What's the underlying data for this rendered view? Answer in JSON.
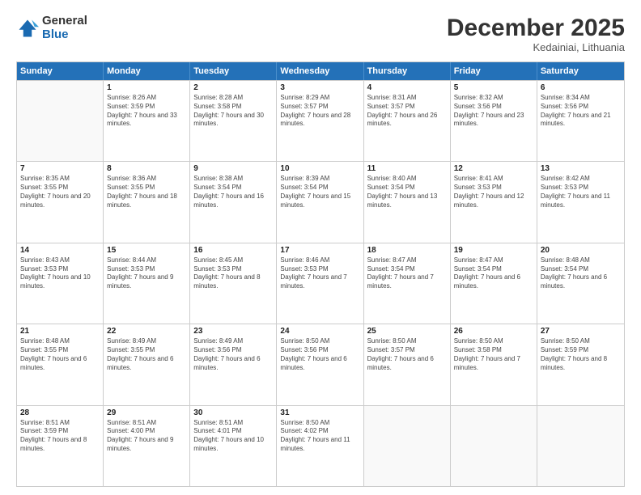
{
  "logo": {
    "general": "General",
    "blue": "Blue"
  },
  "header": {
    "month": "December 2025",
    "location": "Kedainiai, Lithuania"
  },
  "days": [
    "Sunday",
    "Monday",
    "Tuesday",
    "Wednesday",
    "Thursday",
    "Friday",
    "Saturday"
  ],
  "weeks": [
    [
      {
        "day": "",
        "empty": true
      },
      {
        "day": "1",
        "sunrise": "Sunrise: 8:26 AM",
        "sunset": "Sunset: 3:59 PM",
        "daylight": "Daylight: 7 hours and 33 minutes."
      },
      {
        "day": "2",
        "sunrise": "Sunrise: 8:28 AM",
        "sunset": "Sunset: 3:58 PM",
        "daylight": "Daylight: 7 hours and 30 minutes."
      },
      {
        "day": "3",
        "sunrise": "Sunrise: 8:29 AM",
        "sunset": "Sunset: 3:57 PM",
        "daylight": "Daylight: 7 hours and 28 minutes."
      },
      {
        "day": "4",
        "sunrise": "Sunrise: 8:31 AM",
        "sunset": "Sunset: 3:57 PM",
        "daylight": "Daylight: 7 hours and 26 minutes."
      },
      {
        "day": "5",
        "sunrise": "Sunrise: 8:32 AM",
        "sunset": "Sunset: 3:56 PM",
        "daylight": "Daylight: 7 hours and 23 minutes."
      },
      {
        "day": "6",
        "sunrise": "Sunrise: 8:34 AM",
        "sunset": "Sunset: 3:56 PM",
        "daylight": "Daylight: 7 hours and 21 minutes."
      }
    ],
    [
      {
        "day": "7",
        "sunrise": "Sunrise: 8:35 AM",
        "sunset": "Sunset: 3:55 PM",
        "daylight": "Daylight: 7 hours and 20 minutes."
      },
      {
        "day": "8",
        "sunrise": "Sunrise: 8:36 AM",
        "sunset": "Sunset: 3:55 PM",
        "daylight": "Daylight: 7 hours and 18 minutes."
      },
      {
        "day": "9",
        "sunrise": "Sunrise: 8:38 AM",
        "sunset": "Sunset: 3:54 PM",
        "daylight": "Daylight: 7 hours and 16 minutes."
      },
      {
        "day": "10",
        "sunrise": "Sunrise: 8:39 AM",
        "sunset": "Sunset: 3:54 PM",
        "daylight": "Daylight: 7 hours and 15 minutes."
      },
      {
        "day": "11",
        "sunrise": "Sunrise: 8:40 AM",
        "sunset": "Sunset: 3:54 PM",
        "daylight": "Daylight: 7 hours and 13 minutes."
      },
      {
        "day": "12",
        "sunrise": "Sunrise: 8:41 AM",
        "sunset": "Sunset: 3:53 PM",
        "daylight": "Daylight: 7 hours and 12 minutes."
      },
      {
        "day": "13",
        "sunrise": "Sunrise: 8:42 AM",
        "sunset": "Sunset: 3:53 PM",
        "daylight": "Daylight: 7 hours and 11 minutes."
      }
    ],
    [
      {
        "day": "14",
        "sunrise": "Sunrise: 8:43 AM",
        "sunset": "Sunset: 3:53 PM",
        "daylight": "Daylight: 7 hours and 10 minutes."
      },
      {
        "day": "15",
        "sunrise": "Sunrise: 8:44 AM",
        "sunset": "Sunset: 3:53 PM",
        "daylight": "Daylight: 7 hours and 9 minutes."
      },
      {
        "day": "16",
        "sunrise": "Sunrise: 8:45 AM",
        "sunset": "Sunset: 3:53 PM",
        "daylight": "Daylight: 7 hours and 8 minutes."
      },
      {
        "day": "17",
        "sunrise": "Sunrise: 8:46 AM",
        "sunset": "Sunset: 3:53 PM",
        "daylight": "Daylight: 7 hours and 7 minutes."
      },
      {
        "day": "18",
        "sunrise": "Sunrise: 8:47 AM",
        "sunset": "Sunset: 3:54 PM",
        "daylight": "Daylight: 7 hours and 7 minutes."
      },
      {
        "day": "19",
        "sunrise": "Sunrise: 8:47 AM",
        "sunset": "Sunset: 3:54 PM",
        "daylight": "Daylight: 7 hours and 6 minutes."
      },
      {
        "day": "20",
        "sunrise": "Sunrise: 8:48 AM",
        "sunset": "Sunset: 3:54 PM",
        "daylight": "Daylight: 7 hours and 6 minutes."
      }
    ],
    [
      {
        "day": "21",
        "sunrise": "Sunrise: 8:48 AM",
        "sunset": "Sunset: 3:55 PM",
        "daylight": "Daylight: 7 hours and 6 minutes."
      },
      {
        "day": "22",
        "sunrise": "Sunrise: 8:49 AM",
        "sunset": "Sunset: 3:55 PM",
        "daylight": "Daylight: 7 hours and 6 minutes."
      },
      {
        "day": "23",
        "sunrise": "Sunrise: 8:49 AM",
        "sunset": "Sunset: 3:56 PM",
        "daylight": "Daylight: 7 hours and 6 minutes."
      },
      {
        "day": "24",
        "sunrise": "Sunrise: 8:50 AM",
        "sunset": "Sunset: 3:56 PM",
        "daylight": "Daylight: 7 hours and 6 minutes."
      },
      {
        "day": "25",
        "sunrise": "Sunrise: 8:50 AM",
        "sunset": "Sunset: 3:57 PM",
        "daylight": "Daylight: 7 hours and 6 minutes."
      },
      {
        "day": "26",
        "sunrise": "Sunrise: 8:50 AM",
        "sunset": "Sunset: 3:58 PM",
        "daylight": "Daylight: 7 hours and 7 minutes."
      },
      {
        "day": "27",
        "sunrise": "Sunrise: 8:50 AM",
        "sunset": "Sunset: 3:59 PM",
        "daylight": "Daylight: 7 hours and 8 minutes."
      }
    ],
    [
      {
        "day": "28",
        "sunrise": "Sunrise: 8:51 AM",
        "sunset": "Sunset: 3:59 PM",
        "daylight": "Daylight: 7 hours and 8 minutes."
      },
      {
        "day": "29",
        "sunrise": "Sunrise: 8:51 AM",
        "sunset": "Sunset: 4:00 PM",
        "daylight": "Daylight: 7 hours and 9 minutes."
      },
      {
        "day": "30",
        "sunrise": "Sunrise: 8:51 AM",
        "sunset": "Sunset: 4:01 PM",
        "daylight": "Daylight: 7 hours and 10 minutes."
      },
      {
        "day": "31",
        "sunrise": "Sunrise: 8:50 AM",
        "sunset": "Sunset: 4:02 PM",
        "daylight": "Daylight: 7 hours and 11 minutes."
      },
      {
        "day": "",
        "empty": true
      },
      {
        "day": "",
        "empty": true
      },
      {
        "day": "",
        "empty": true
      }
    ]
  ]
}
